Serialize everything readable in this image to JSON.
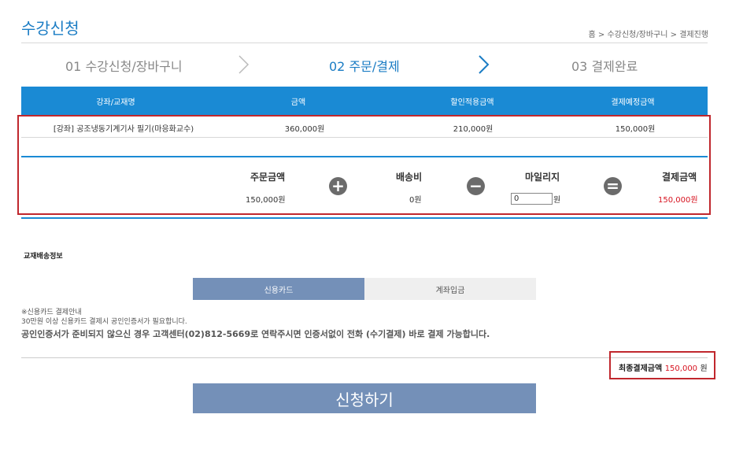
{
  "header": {
    "title": "수강신청",
    "breadcrumb": [
      "홈",
      "수강신청/장바구니",
      "결제진행"
    ]
  },
  "steps": [
    {
      "label": "01 수강신청/장바구니",
      "active": false
    },
    {
      "label": "02 주문/결제",
      "active": true
    },
    {
      "label": "03 결제완료",
      "active": false
    }
  ],
  "table": {
    "columns": [
      "강좌/교재명",
      "금액",
      "할인적용금액",
      "결제예정금액"
    ],
    "rows": [
      [
        "[강좌] 공조냉동기계기사 필기(마응화교수)",
        "360,000원",
        "210,000원",
        "150,000원"
      ]
    ]
  },
  "summary": {
    "order_label": "주문금액",
    "order_value": "150,000원",
    "shipping_label": "배송비",
    "shipping_value": "0원",
    "mileage_label": "마일리지",
    "mileage_input": "0",
    "mileage_unit": "원",
    "payment_label": "결제금액",
    "payment_value": "150,000원"
  },
  "delivery": {
    "section_title": "교재배송정보"
  },
  "payment_tabs": [
    {
      "label": "신용카드",
      "active": true
    },
    {
      "label": "계좌입금",
      "active": false
    }
  ],
  "notes": {
    "line1": "※신용카드 결제안내",
    "line2": "30만원 이상 신용카드 결제시 공인인증서가 필요합니다.",
    "line3": "공인인증서가 준비되지 않으신 경우 고객센터(02)812-5669로 연락주시면 인증서없이 전화 (수기결제) 바로 결제 가능합니다."
  },
  "final": {
    "label": "최종결제금액",
    "amount": "150,000",
    "unit": "원"
  },
  "submit_label": "신청하기",
  "colors": {
    "primary_blue": "#1a8ad4",
    "tab_blue": "#7490b8",
    "highlight_red": "#d7121f",
    "box_red": "#c0272d"
  }
}
